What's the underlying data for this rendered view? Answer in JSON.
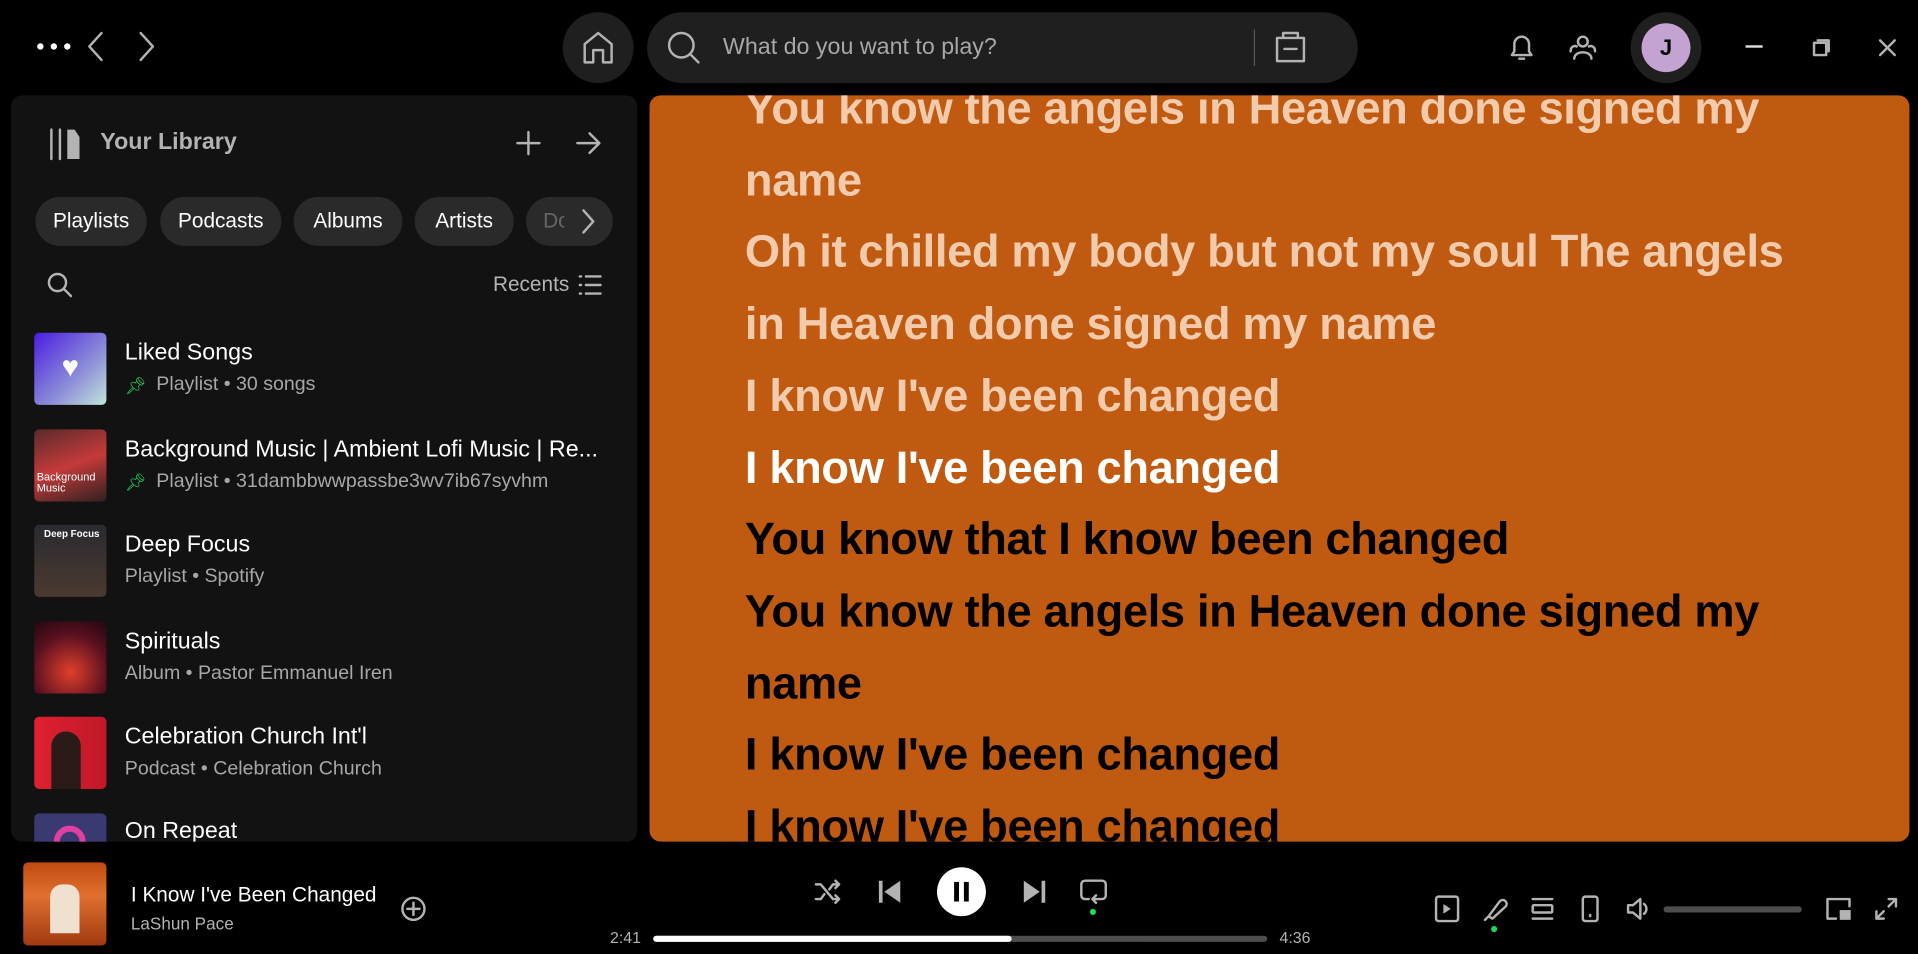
{
  "topbar": {
    "search_placeholder": "What do you want to play?",
    "avatar_initial": "J"
  },
  "library": {
    "title": "Your Library",
    "filters": [
      "Playlists",
      "Podcasts",
      "Albums",
      "Artists",
      "Downloaded"
    ],
    "sort_label": "Recents",
    "items": [
      {
        "title": "Liked Songs",
        "subtitle": "Playlist • 30 songs",
        "pinned": true
      },
      {
        "title": "Background Music | Ambient Lofi Music | Re...",
        "subtitle": "Playlist • 31dambbwwpassbe3wv7ib67syvhm",
        "pinned": true,
        "art_text": "Background Music"
      },
      {
        "title": "Deep Focus",
        "subtitle": "Playlist • Spotify",
        "pinned": false,
        "art_text": "Deep Focus"
      },
      {
        "title": "Spirituals",
        "subtitle": "Album • Pastor Emmanuel Iren",
        "pinned": false
      },
      {
        "title": "Celebration Church Int'l",
        "subtitle": "Podcast • Celebration Church",
        "pinned": false
      },
      {
        "title": "On Repeat",
        "subtitle": "",
        "pinned": false
      }
    ]
  },
  "lyrics": {
    "background_color": "#c05a10",
    "lines": [
      {
        "text": "You know the angels in Heaven done signed my name",
        "state": "past"
      },
      {
        "text": "Oh it chilled my body but not my soul The angels in Heaven done signed my name",
        "state": "past"
      },
      {
        "text": "I know I've been changed",
        "state": "past"
      },
      {
        "text": "I know I've been changed",
        "state": "current"
      },
      {
        "text": "You know that I know been changed",
        "state": "upcoming"
      },
      {
        "text": "You know the angels in Heaven done signed my name",
        "state": "upcoming"
      },
      {
        "text": "I know I've been changed",
        "state": "upcoming"
      },
      {
        "text": "I know I've been changed",
        "state": "upcoming"
      }
    ]
  },
  "player": {
    "track_title": "I Know I've Been Changed",
    "artist": "LaShun Pace",
    "elapsed": "2:41",
    "duration": "4:36",
    "progress_fraction": 0.583,
    "volume_fraction": 0,
    "accent_color": "#1ed760",
    "repeat_active": true,
    "lyrics_active": true
  }
}
